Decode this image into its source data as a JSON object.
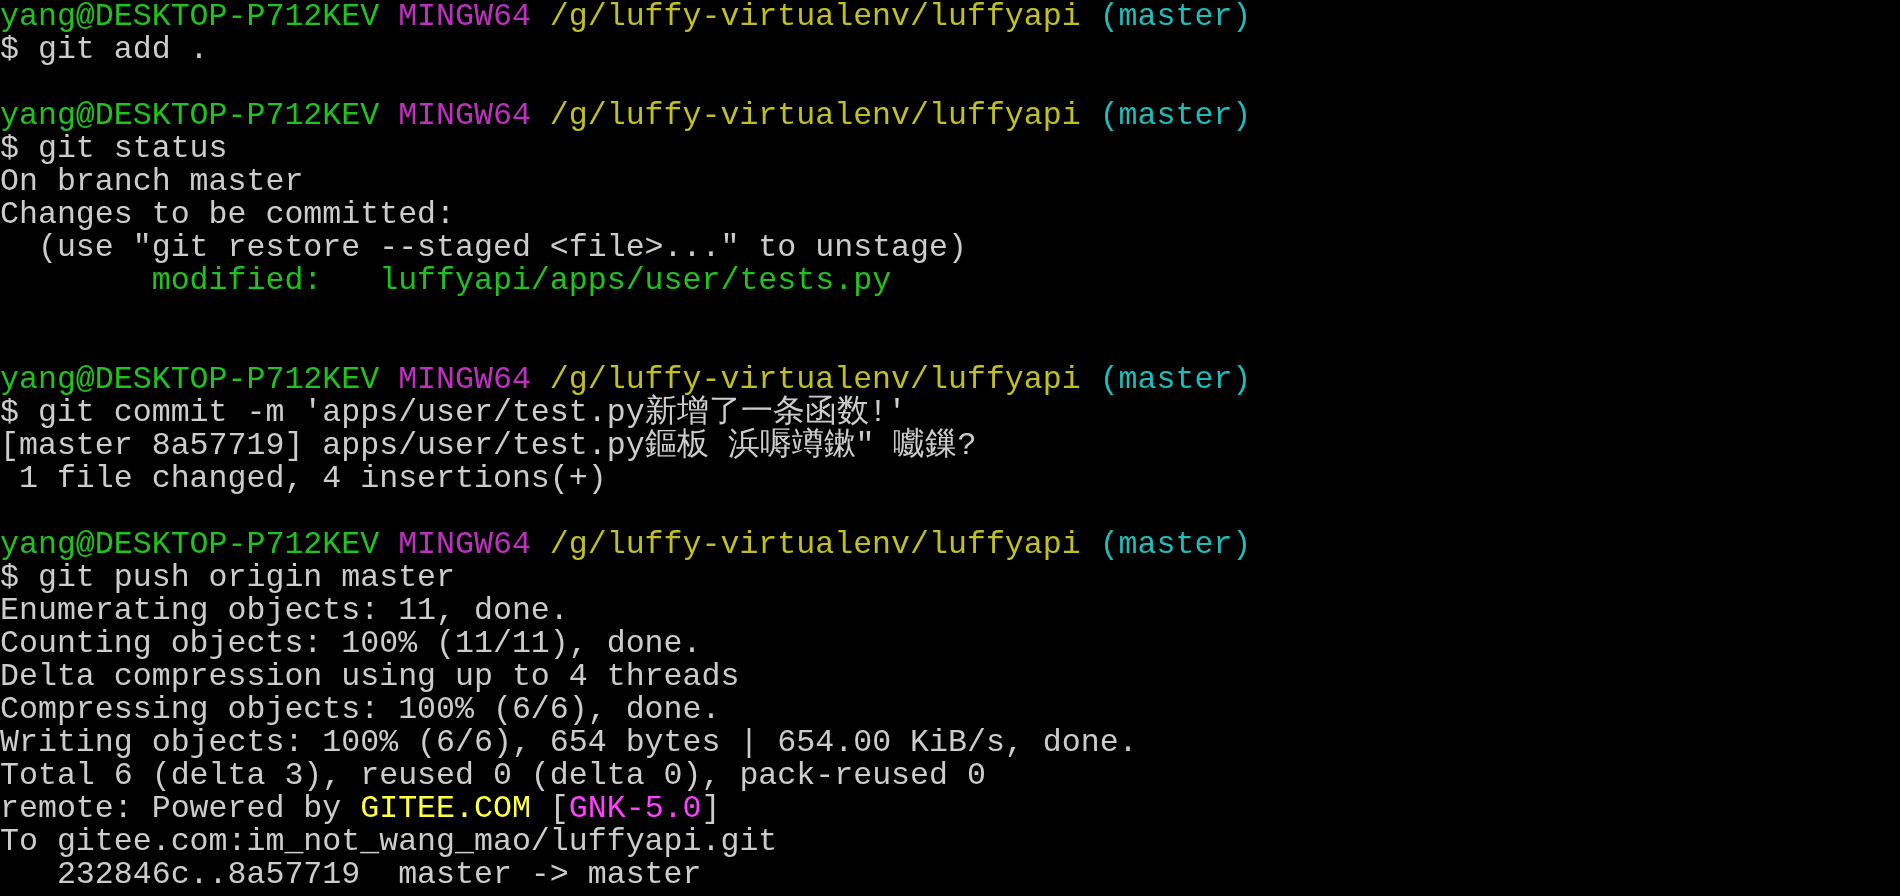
{
  "terminal": {
    "lines": [
      {
        "kind": "prompt",
        "segments": [
          {
            "kind": "user-host",
            "text": "yang@DESKTOP-P712KEV",
            "color": "#1fc21f"
          },
          {
            "kind": "system",
            "text": "MINGW64",
            "color": "#c030c0"
          },
          {
            "kind": "path",
            "text": "/g/luffy-virtualenv/luffyapi",
            "color": "#c0c020"
          },
          {
            "kind": "branch",
            "text": "(master)",
            "color": "#1fbcbc"
          }
        ]
      },
      {
        "kind": "command",
        "segments": [
          {
            "kind": "command",
            "text": "$ git add .",
            "color": "#cccccc"
          }
        ]
      },
      {
        "kind": "blank"
      },
      {
        "kind": "prompt",
        "segments": [
          {
            "kind": "user-host",
            "text": "yang@DESKTOP-P712KEV",
            "color": "#1fc21f"
          },
          {
            "kind": "system",
            "text": "MINGW64",
            "color": "#c030c0"
          },
          {
            "kind": "path",
            "text": "/g/luffy-virtualenv/luffyapi",
            "color": "#c0c020"
          },
          {
            "kind": "branch",
            "text": "(master)",
            "color": "#1fbcbc"
          }
        ]
      },
      {
        "kind": "command",
        "segments": [
          {
            "kind": "command",
            "text": "$ git status",
            "color": "#cccccc"
          }
        ]
      },
      {
        "kind": "output",
        "segments": [
          {
            "kind": "output",
            "text": "On branch master",
            "color": "#cccccc"
          }
        ]
      },
      {
        "kind": "output",
        "segments": [
          {
            "kind": "output",
            "text": "Changes to be committed:",
            "color": "#cccccc"
          }
        ]
      },
      {
        "kind": "output",
        "segments": [
          {
            "kind": "output",
            "text": "  (use \"git restore --staged <file>...\" to unstage)",
            "color": "#cccccc"
          }
        ]
      },
      {
        "kind": "output",
        "segments": [
          {
            "kind": "staged-file",
            "text": "        modified:   luffyapi/apps/user/tests.py",
            "color": "#1fc21f"
          }
        ]
      },
      {
        "kind": "blank"
      },
      {
        "kind": "blank"
      },
      {
        "kind": "prompt",
        "segments": [
          {
            "kind": "user-host",
            "text": "yang@DESKTOP-P712KEV",
            "color": "#1fc21f"
          },
          {
            "kind": "system",
            "text": "MINGW64",
            "color": "#c030c0"
          },
          {
            "kind": "path",
            "text": "/g/luffy-virtualenv/luffyapi",
            "color": "#c0c020"
          },
          {
            "kind": "branch",
            "text": "(master)",
            "color": "#1fbcbc"
          }
        ]
      },
      {
        "kind": "command",
        "segments": [
          {
            "kind": "command",
            "text": "$ git commit -m 'apps/user/test.py新增了一条函数!'",
            "color": "#cccccc"
          }
        ]
      },
      {
        "kind": "output",
        "segments": [
          {
            "kind": "output",
            "text": "[master 8a57719] apps/user/test.py鏂板 浜嗕竴鏉″ 嚱鏁?",
            "color": "#cccccc"
          }
        ]
      },
      {
        "kind": "output",
        "segments": [
          {
            "kind": "output",
            "text": " 1 file changed, 4 insertions(+)",
            "color": "#cccccc"
          }
        ]
      },
      {
        "kind": "blank"
      },
      {
        "kind": "prompt",
        "segments": [
          {
            "kind": "user-host",
            "text": "yang@DESKTOP-P712KEV",
            "color": "#1fc21f"
          },
          {
            "kind": "system",
            "text": "MINGW64",
            "color": "#c030c0"
          },
          {
            "kind": "path",
            "text": "/g/luffy-virtualenv/luffyapi",
            "color": "#c0c020"
          },
          {
            "kind": "branch",
            "text": "(master)",
            "color": "#1fbcbc"
          }
        ]
      },
      {
        "kind": "command",
        "segments": [
          {
            "kind": "command",
            "text": "$ git push origin master",
            "color": "#cccccc"
          }
        ]
      },
      {
        "kind": "output",
        "segments": [
          {
            "kind": "output",
            "text": "Enumerating objects: 11, done.",
            "color": "#cccccc"
          }
        ]
      },
      {
        "kind": "output",
        "segments": [
          {
            "kind": "output",
            "text": "Counting objects: 100% (11/11), done.",
            "color": "#cccccc"
          }
        ]
      },
      {
        "kind": "output",
        "segments": [
          {
            "kind": "output",
            "text": "Delta compression using up to 4 threads",
            "color": "#cccccc"
          }
        ]
      },
      {
        "kind": "output",
        "segments": [
          {
            "kind": "output",
            "text": "Compressing objects: 100% (6/6), done.",
            "color": "#cccccc"
          }
        ]
      },
      {
        "kind": "output",
        "segments": [
          {
            "kind": "output",
            "text": "Writing objects: 100% (6/6), 654 bytes | 654.00 KiB/s, done.",
            "color": "#cccccc"
          }
        ]
      },
      {
        "kind": "output",
        "segments": [
          {
            "kind": "output",
            "text": "Total 6 (delta 3), reused 0 (delta 0), pack-reused 0",
            "color": "#cccccc"
          }
        ]
      },
      {
        "kind": "output",
        "segments": [
          {
            "kind": "output",
            "text": "remote: Powered by",
            "color": "#cccccc"
          },
          {
            "kind": "remote-host",
            "text": "GITEE.COM",
            "color": "#ffff40"
          },
          {
            "kind": "output",
            "text": "[",
            "color": "#cccccc"
          },
          {
            "kind": "version-tag",
            "text": "GNK-5.0",
            "color": "#ff40ff"
          },
          {
            "kind": "output",
            "text": "]",
            "color": "#cccccc"
          }
        ]
      },
      {
        "kind": "output",
        "segments": [
          {
            "kind": "output",
            "text": "To gitee.com:im_not_wang_mao/luffyapi.git",
            "color": "#cccccc"
          }
        ]
      },
      {
        "kind": "output",
        "segments": [
          {
            "kind": "output",
            "text": "   232846c..8a57719  master -> master",
            "color": "#cccccc"
          }
        ]
      }
    ]
  }
}
